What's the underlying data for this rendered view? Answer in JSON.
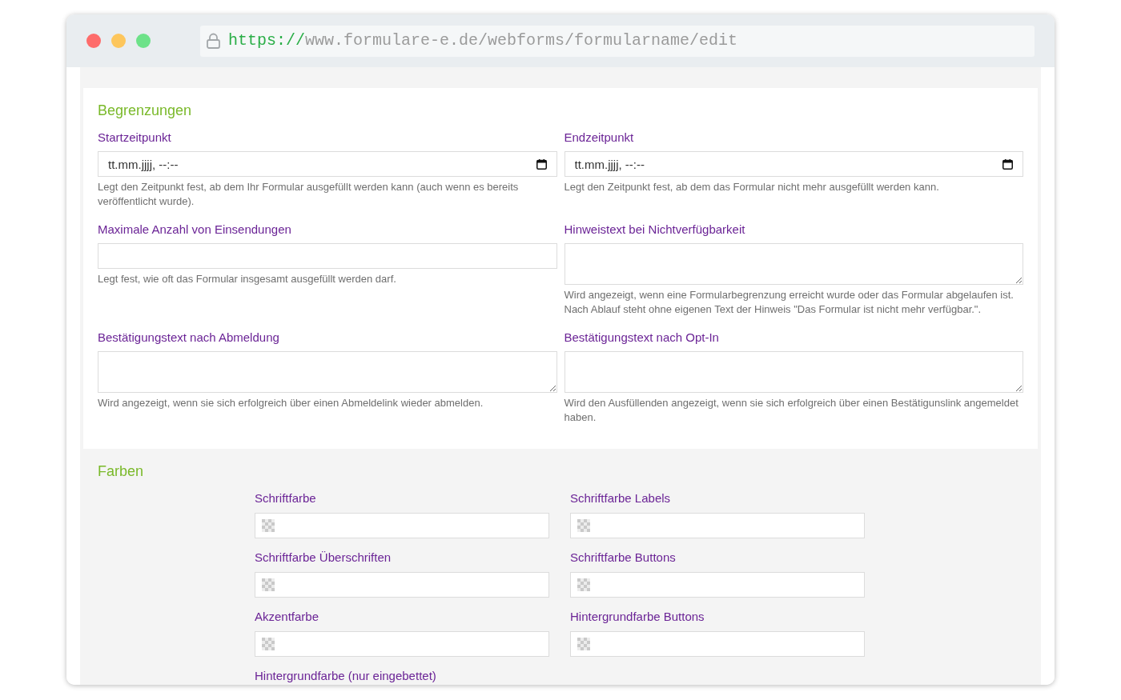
{
  "browser": {
    "url": {
      "scheme": "https://",
      "rest": "www.formulare-e.de/webforms/formularname/edit"
    }
  },
  "limits": {
    "title": "Begrenzungen",
    "fields": [
      {
        "kind": "datetime",
        "label": "Startzeitpunkt",
        "placeholder": "tt.mm.jjjj, --:--",
        "help": "Legt den Zeitpunkt fest, ab dem Ihr Formular ausgefüllt werden kann (auch wenn es bereits veröffentlicht wurde)."
      },
      {
        "kind": "datetime",
        "label": "Endzeitpunkt",
        "placeholder": "tt.mm.jjjj, --:--",
        "help": "Legt den Zeitpunkt fest, ab dem das Formular nicht mehr ausgefüllt werden kann."
      },
      {
        "kind": "input",
        "label": "Maximale Anzahl von Einsendungen",
        "help": "Legt fest, wie oft das Formular insgesamt ausgefüllt werden darf."
      },
      {
        "kind": "textarea",
        "label": "Hinweistext bei Nichtverfügbarkeit",
        "help": "Wird angezeigt, wenn eine Formularbegrenzung erreicht wurde oder das Formular abgelaufen ist. Nach Ablauf steht ohne eigenen Text der Hinweis \"Das Formular ist nicht mehr verfügbar.\"."
      },
      {
        "kind": "textarea",
        "label": "Bestätigungstext nach Abmeldung",
        "help": "Wird angezeigt, wenn sie sich erfolgreich über einen Abmeldelink wieder abmelden."
      },
      {
        "kind": "textarea",
        "label": "Bestätigungstext nach Opt-In",
        "help": "Wird den Ausfüllenden angezeigt, wenn sie sich erfolgreich über einen Bestätigunslink angemeldet haben."
      }
    ]
  },
  "colors": {
    "title": "Farben",
    "fields": [
      {
        "kind": "color",
        "label": "Schriftfarbe"
      },
      {
        "kind": "color",
        "label": "Schriftfarbe Labels"
      },
      {
        "kind": "color",
        "label": "Schriftfarbe Überschriften"
      },
      {
        "kind": "color",
        "label": "Schriftfarbe Buttons"
      },
      {
        "kind": "color",
        "label": "Akzentfarbe"
      },
      {
        "kind": "color",
        "label": "Hintergrundfarbe Buttons"
      },
      {
        "kind": "label_only",
        "label": "Hintergrundfarbe (nur eingebettet)"
      }
    ]
  }
}
